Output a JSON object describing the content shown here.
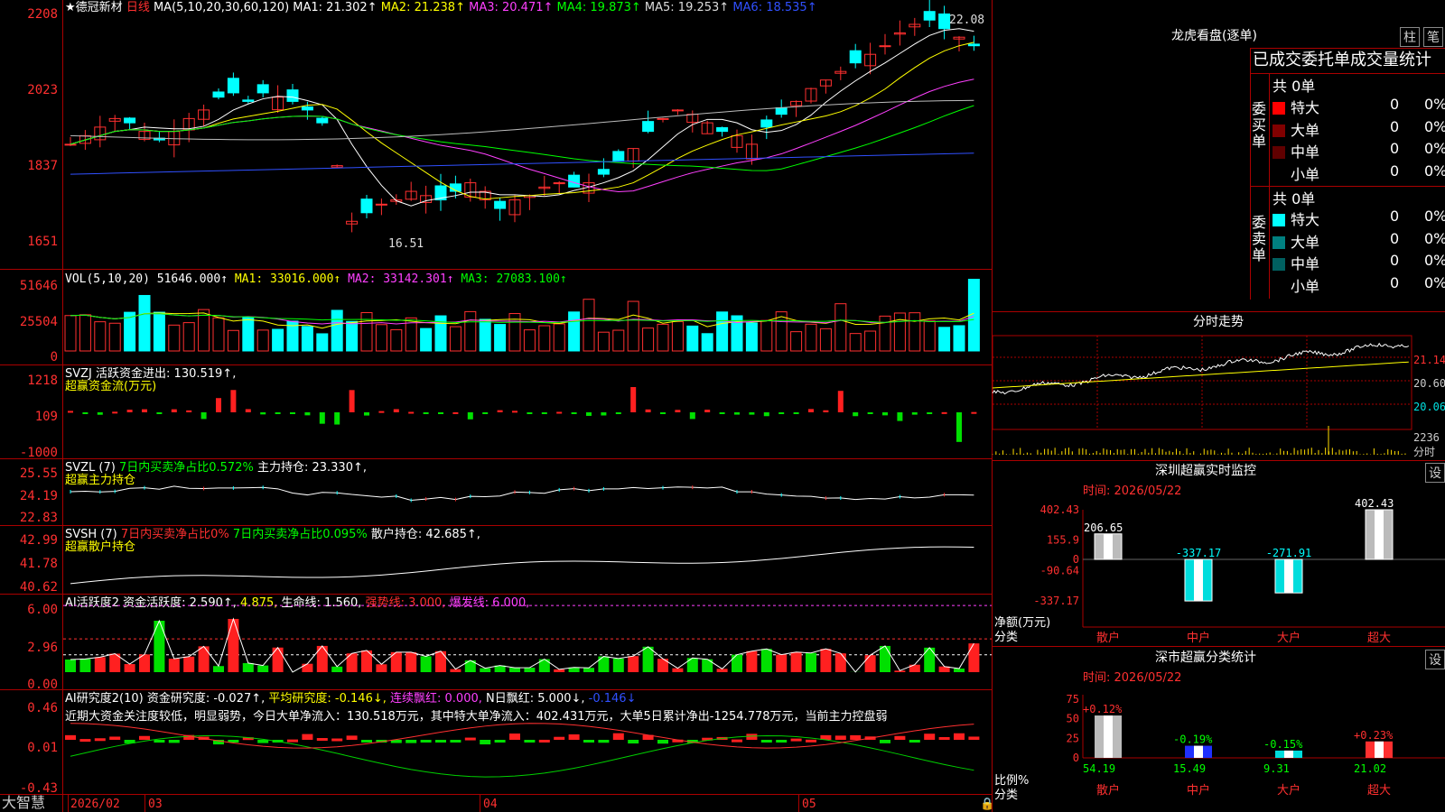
{
  "title": {
    "star": "★",
    "name": "德冠新材",
    "period": "日线",
    "ma_spec": "MA(5,10,20,30,60,120)"
  },
  "ma_values": [
    {
      "label": "MA1: 21.302↑",
      "color": "#ffffff"
    },
    {
      "label": "MA2: 21.238↑",
      "color": "#ffff00"
    },
    {
      "label": "MA3: 20.471↑",
      "color": "#ff40ff"
    },
    {
      "label": "MA4: 19.873↑",
      "color": "#00ff00"
    },
    {
      "label": "MA5: 19.253↑",
      "color": "#dddddd"
    },
    {
      "label": "MA6: 18.535↑",
      "color": "#3050ff"
    }
  ],
  "price_axis": [
    "2208",
    "2023",
    "1837",
    "1651"
  ],
  "price_annotations": {
    "high": "22.08",
    "low": "16.51"
  },
  "vol": {
    "spec": "VOL(5,10,20)",
    "value": "51646.000↑",
    "ma1": "MA1: 33016.000↑",
    "ma2": "MA2: 33142.301↑",
    "ma3": "MA3: 27083.100↑",
    "axis": [
      "51646",
      "25504",
      "0"
    ]
  },
  "svzj": {
    "name": "SVZJ",
    "label": "活跃资金进出: 130.519↑,",
    "sub": "超赢资金流(万元)",
    "axis": [
      "1218",
      "109",
      "-1000"
    ]
  },
  "svzl": {
    "name": "SVZL (7)",
    "a": "7日内买卖净占比0.572%",
    "b": "主力持仓: 23.330↑,",
    "sub": "超赢主力持仓",
    "axis": [
      "25.55",
      "24.19",
      "22.83"
    ]
  },
  "svsh": {
    "name": "SVSH (7)",
    "a": "7日内买卖净占比0%",
    "b": "7日内买卖净占比0.095%",
    "c": "散户持仓: 42.685↑,",
    "sub": "超赢散户持仓",
    "axis": [
      "42.99",
      "41.78",
      "40.62"
    ]
  },
  "ai1": {
    "name": "AI活跃度2",
    "a": "资金活跃度: 2.590↑,",
    "b": "4.875,",
    "c": "生命线: 1.560,",
    "d": "强势线: 3.000,",
    "e": "爆发线: 6.000,",
    "axis": [
      "6.00",
      "2.96",
      "0.00"
    ]
  },
  "ai2": {
    "name": "AI研究度2(10)",
    "a": "资金研究度: -0.027↑,",
    "b": "平均研究度: -0.146↓,",
    "c": "连续飘红: 0.000,",
    "d": "N日飘红: 5.000↓,",
    "e": "-0.146↓",
    "axis": [
      "0.46",
      "0.01",
      "-0.43"
    ],
    "note": "近期大资金关注度较低，明显弱势，今日大单净流入：130.518万元，其中特大单净流入：402.431万元，大单5日累计净出-1254.778万元，当前主力控盘弱"
  },
  "x_axis": {
    "brand": "大智慧",
    "labels": [
      "2026/02",
      "03",
      "04",
      "05"
    ]
  },
  "longhu": {
    "title": "龙虎看盘(逐单)",
    "btn1": "柱",
    "btn2": "笔",
    "header": "已成交委托单成交量统计",
    "buy": {
      "side": "委买单",
      "total": "共 0单",
      "rows": [
        [
          "特大",
          "0",
          "0%"
        ],
        [
          "大单",
          "0",
          "0%"
        ],
        [
          "中单",
          "0",
          "0%"
        ],
        [
          "小单",
          "0",
          "0%"
        ]
      ]
    },
    "sell": {
      "side": "委卖单",
      "total": "共 0单",
      "rows": [
        [
          "特大",
          "0",
          "0%"
        ],
        [
          "大单",
          "0",
          "0%"
        ],
        [
          "中单",
          "0",
          "0%"
        ],
        [
          "小单",
          "0",
          "0%"
        ]
      ]
    }
  },
  "fenshi": {
    "title": "分时走势",
    "axis": [
      "21.14",
      "20.60",
      "20.06",
      "2236",
      "分时"
    ]
  },
  "monitor": {
    "title": "深圳超赢实时监控",
    "btn": "设",
    "time": "时间: 2026/05/22",
    "axis": [
      "402.43",
      "155.9",
      "0",
      "-90.64",
      "-337.17"
    ],
    "ylabel": "净额(万元)",
    "xlabel": "分类",
    "chart_data": {
      "type": "bar",
      "categories": [
        "散户",
        "中户",
        "大户",
        "超大"
      ],
      "values": [
        206.65,
        -337.17,
        -271.91,
        402.43
      ],
      "labels": [
        "206.65",
        "-337.17",
        "-271.91",
        "402.43"
      ]
    }
  },
  "classstat": {
    "title": "深市超赢分类统计",
    "btn": "设",
    "time": "时间: 2026/05/22",
    "axis": [
      "75",
      "50",
      "25",
      "0"
    ],
    "ylabel": "比例%",
    "xlabel": "分类",
    "chart_data": {
      "type": "bar",
      "categories": [
        "散户",
        "中户",
        "大户",
        "超大"
      ],
      "values": [
        54.19,
        15.49,
        9.31,
        21.02
      ],
      "changes": [
        "+0.12%",
        "-0.19%",
        "-0.15%",
        "+0.23%"
      ]
    }
  }
}
